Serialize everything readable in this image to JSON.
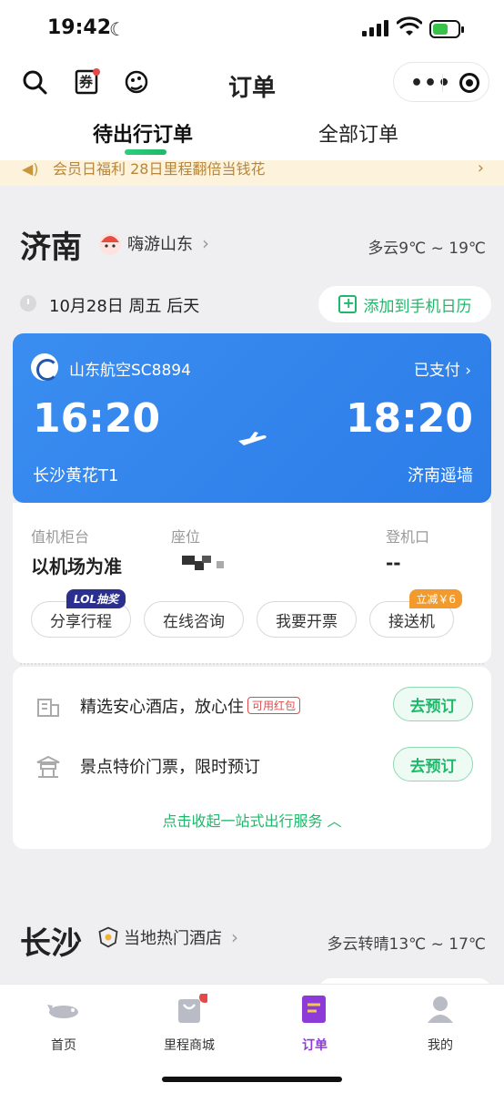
{
  "status": {
    "time": "19:42"
  },
  "nav": {
    "title": "订单",
    "coupon_label": "券"
  },
  "tabs": [
    {
      "label": "待出行订单"
    },
    {
      "label": "全部订单"
    }
  ],
  "notice": {
    "text": "会员日福利 28日里程翻倍当钱花"
  },
  "trip1": {
    "city": "济南",
    "promo": "嗨游山东",
    "weather": "多云9℃ ~ 19℃",
    "date": "10月28日 周五 后天",
    "calendar_btn": "添加到手机日历",
    "flight": {
      "airline": "山东航空SC8894",
      "status": "已支付",
      "dep_time": "16:20",
      "arr_time": "18:20",
      "dep_place": "长沙黄花T1",
      "arr_place": "济南遥墙"
    },
    "info": {
      "checkin_label": "值机柜台",
      "checkin_value": "以机场为准",
      "seat_label": "座位",
      "gate_label": "登机口",
      "gate_value": "--"
    },
    "actions": [
      {
        "label": "分享行程",
        "tag": "LOL抽奖"
      },
      {
        "label": "在线咨询"
      },
      {
        "label": "我要开票"
      },
      {
        "label": "接送机",
        "tag": "立减￥6"
      }
    ]
  },
  "services": {
    "hotel_text": "精选安心酒店，放心住",
    "hotel_tag": "可用红包",
    "ticket_text": "景点特价门票，限时预订",
    "book_label": "去预订",
    "collapse": "点击收起一站式出行服务"
  },
  "trip2": {
    "city": "长沙",
    "promo": "当地热门酒店",
    "weather": "多云转晴13℃ ~ 17℃"
  },
  "tabbar": [
    {
      "label": "首页"
    },
    {
      "label": "里程商城"
    },
    {
      "label": "订单"
    },
    {
      "label": "我的"
    }
  ],
  "colors": {
    "accent": "#1fb86a",
    "ticket_blue": "#2c7de8",
    "active_tab": "#8c3ad8"
  }
}
